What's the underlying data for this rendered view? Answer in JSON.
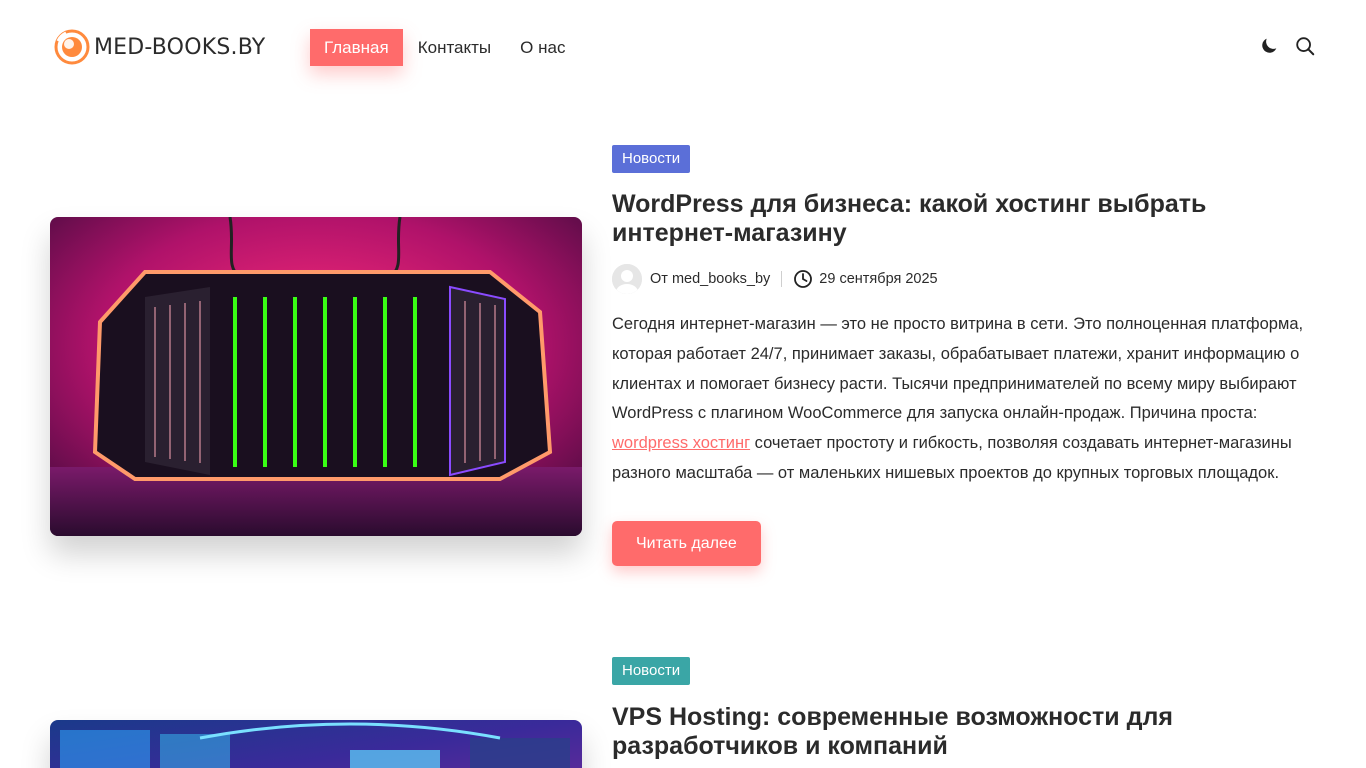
{
  "header": {
    "logo_text": "MED-BOOKS.BY",
    "nav": [
      {
        "label": "Главная",
        "active": true
      },
      {
        "label": "Контакты",
        "active": false
      },
      {
        "label": "О нас",
        "active": false
      }
    ],
    "icons": [
      "moon-icon",
      "search-icon"
    ]
  },
  "colors": {
    "accent": "#ff6b6b",
    "category_news_1": "#5b6fd8",
    "category_news_2": "#3aa6a6",
    "text": "#2b2b2b"
  },
  "posts": [
    {
      "category": "Новости",
      "title": "WordPress для бизнеса: какой хостинг выбрать интернет-магазину",
      "author_prefix": "От",
      "author": "med_books_by",
      "date": "29 сентября 2025",
      "excerpt_before": "Сегодня интернет-магазин — это не просто витрина в сети. Это полноценная платформа, которая работает 24/7, принимает заказы, обрабатывает платежи, хранит информацию о клиентах и помогает бизнесу расти. Тысячи предпринимателей по всему миру выбирают WordPress с плагином WooCommerce для запуска онлайн-продаж. Причина проста: ",
      "excerpt_link": "wordpress хостинг",
      "excerpt_after": " сочетает простоту и гибкость, позволяя создавать интернет-магазины разного масштаба — от маленьких нишевых проектов до крупных торговых площадок.",
      "read_more": "Читать далее"
    },
    {
      "category": "Новости",
      "title": "VPS Hosting: современные возможности для разработчиков и компаний"
    }
  ]
}
